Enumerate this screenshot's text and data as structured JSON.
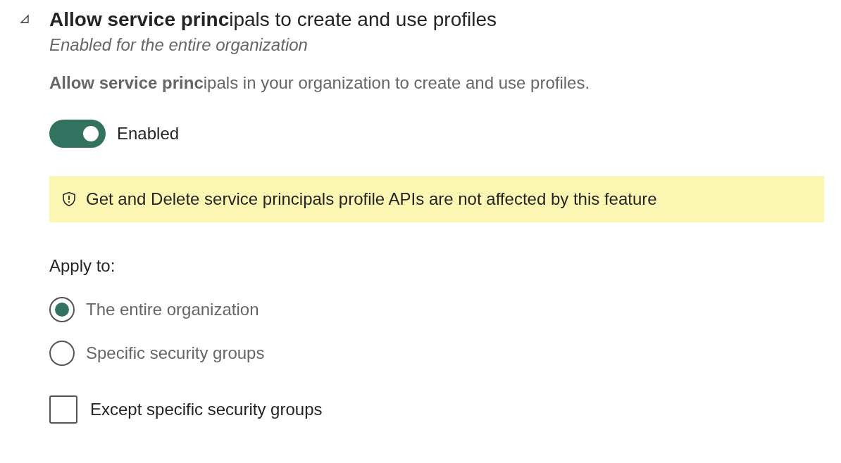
{
  "setting": {
    "title": "**Allow service princ**ipals to create and use profiles",
    "expanded": true,
    "subtitle": "Enabled for the entire organization",
    "description": "**Allow service princ**ipals in your organization to create and use profiles.",
    "toggle": {
      "on": true,
      "label": "Enabled"
    },
    "notice": "Get and Delete service principals profile APIs are not affected by this feature",
    "apply_to": {
      "label": "Apply to:",
      "options": [
        {
          "label": "The entire organization",
          "selected": true
        },
        {
          "label": "Specific security groups",
          "selected": false
        }
      ]
    },
    "except": {
      "label": "Except specific security groups",
      "checked": false
    }
  }
}
